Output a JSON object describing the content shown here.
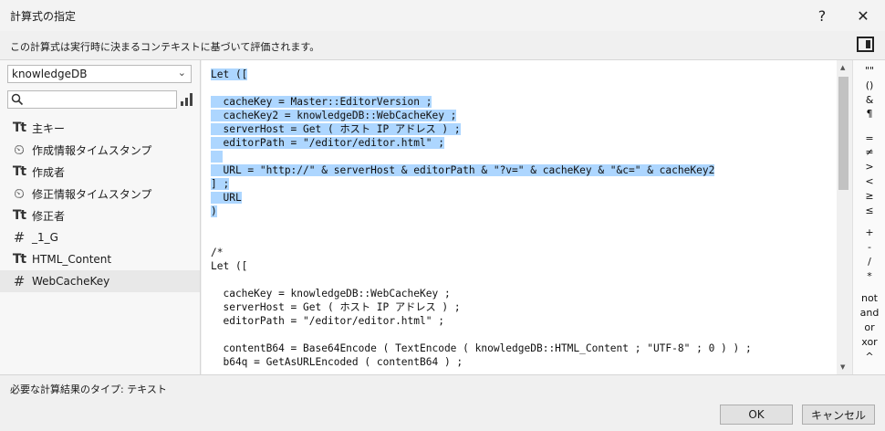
{
  "window": {
    "title": "計算式の指定",
    "help_label": "?",
    "close_label": "✕"
  },
  "subtitle": "この計算式は実行時に決まるコンテキストに基づいて評価されます。",
  "table_select": {
    "value": "knowledgeDB",
    "chevron": "⌄"
  },
  "search": {
    "placeholder": ""
  },
  "fields": [
    {
      "icon": "Tt",
      "type": "text",
      "name": "主キー"
    },
    {
      "icon": "⏲",
      "type": "timestamp",
      "name": "作成情報タイムスタンプ"
    },
    {
      "icon": "Tt",
      "type": "text",
      "name": "作成者"
    },
    {
      "icon": "⏲",
      "type": "timestamp",
      "name": "修正情報タイムスタンプ"
    },
    {
      "icon": "Tt",
      "type": "text",
      "name": "修正者"
    },
    {
      "icon": "#",
      "type": "number",
      "name": "_1_G"
    },
    {
      "icon": "Tt",
      "type": "text",
      "name": "HTML_Content"
    },
    {
      "icon": "#",
      "type": "number",
      "name": "WebCacheKey"
    }
  ],
  "code_lines": [
    {
      "text": "Let ([",
      "hl": true
    },
    {
      "text": "",
      "hl": false
    },
    {
      "text": "  cacheKey = Master::EditorVersion ;",
      "hl": true
    },
    {
      "text": "  cacheKey2 = knowledgeDB::WebCacheKey ;",
      "hl": true
    },
    {
      "text": "  serverHost = Get ( ホスト IP アドレス ) ;",
      "hl": true
    },
    {
      "text": "  editorPath = \"/editor/editor.html\" ;",
      "hl": true
    },
    {
      "text": "  ",
      "hl": true
    },
    {
      "text": "  URL = \"http://\" & serverHost & editorPath & \"?v=\" & cacheKey & \"&c=\" & cacheKey2",
      "hl": true
    },
    {
      "text": "] ;",
      "hl": true
    },
    {
      "text": "  URL",
      "hl": true
    },
    {
      "text": ")",
      "hl": true
    },
    {
      "text": "",
      "hl": false
    },
    {
      "text": "",
      "hl": false
    },
    {
      "text": "/*",
      "hl": false
    },
    {
      "text": "Let ([",
      "hl": false
    },
    {
      "text": "",
      "hl": false
    },
    {
      "text": "  cacheKey = knowledgeDB::WebCacheKey ;",
      "hl": false
    },
    {
      "text": "  serverHost = Get ( ホスト IP アドレス ) ;",
      "hl": false
    },
    {
      "text": "  editorPath = \"/editor/editor.html\" ;",
      "hl": false
    },
    {
      "text": "",
      "hl": false
    },
    {
      "text": "  contentB64 = Base64Encode ( TextEncode ( knowledgeDB::HTML_Content ; \"UTF-8\" ; 0 ) ) ;",
      "hl": false
    },
    {
      "text": "  b64q = GetAsURLEncoded ( contentB64 ) ;",
      "hl": false
    }
  ],
  "operators": [
    "\"\"",
    "()",
    "&",
    "¶",
    "=",
    "≠",
    ">",
    "<",
    "≥",
    "≤",
    "+",
    "-",
    "/",
    "*",
    "not",
    "and",
    "or",
    "xor",
    "^"
  ],
  "result_type": "必要な計算結果のタイプ: テキスト",
  "buttons": {
    "ok": "OK",
    "cancel": "キャンセル"
  }
}
